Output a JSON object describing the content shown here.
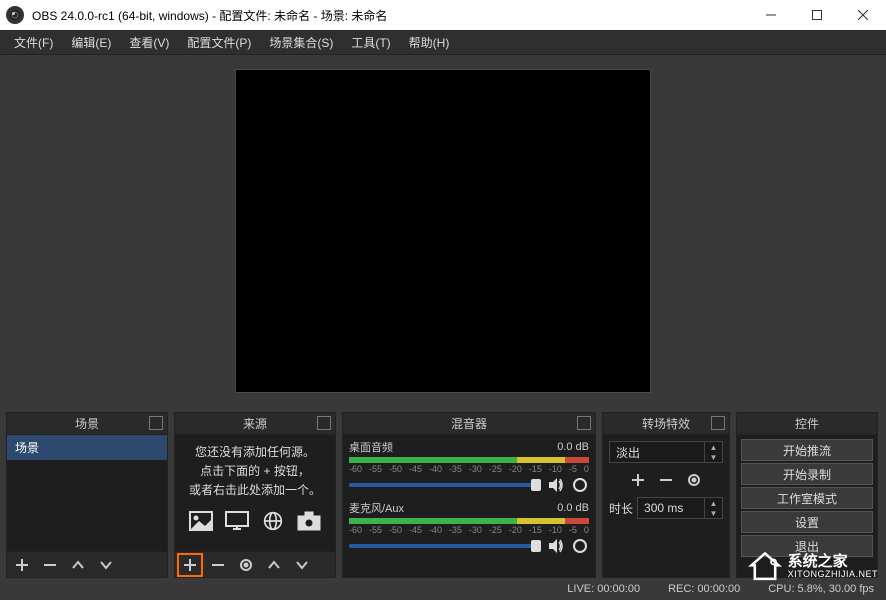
{
  "window": {
    "title": "OBS 24.0.0-rc1 (64-bit, windows) - 配置文件: 未命名 - 场景: 未命名"
  },
  "menu": {
    "file": "文件(F)",
    "edit": "编辑(E)",
    "view": "查看(V)",
    "profiles": "配置文件(P)",
    "scene_collections": "场景集合(S)",
    "tools": "工具(T)",
    "help": "帮助(H)"
  },
  "docks": {
    "scenes": {
      "title": "场景",
      "items": [
        "场景"
      ]
    },
    "sources": {
      "title": "来源",
      "empty_line1": "您还没有添加任何源。",
      "empty_line2": "点击下面的 + 按钮，",
      "empty_line3": "或者右击此处添加一个。"
    },
    "mixer": {
      "title": "混音器",
      "ticks": [
        "-60",
        "-55",
        "-50",
        "-45",
        "-40",
        "-35",
        "-30",
        "-25",
        "-20",
        "-15",
        "-10",
        "-5",
        "0"
      ],
      "channels": [
        {
          "name": "桌面音频",
          "db": "0.0 dB"
        },
        {
          "name": "麦克风/Aux",
          "db": "0.0 dB"
        }
      ]
    },
    "transitions": {
      "title": "转场特效",
      "selected": "淡出",
      "duration_label": "时长",
      "duration_value": "300 ms"
    },
    "controls": {
      "title": "控件",
      "buttons": {
        "start_streaming": "开始推流",
        "start_recording": "开始录制",
        "studio_mode": "工作室模式",
        "settings": "设置",
        "exit": "退出"
      }
    }
  },
  "statusbar": {
    "live": "LIVE: 00:00:00",
    "rec": "REC: 00:00:00",
    "cpu": "CPU: 5.8%, 30.00 fps"
  },
  "watermark": {
    "cn": "系统之家",
    "en": "XITONGZHIJIA.NET"
  }
}
